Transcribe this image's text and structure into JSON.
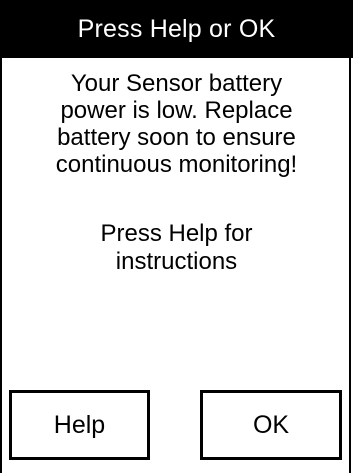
{
  "dialog": {
    "title": "Press Help or OK",
    "message_lines": [
      "Your Sensor battery",
      "power is low. Replace",
      "battery soon to ensure",
      "continuous monitoring!"
    ],
    "instruction_lines": [
      "Press Help for",
      "instructions"
    ],
    "help_label": "Help",
    "ok_label": "OK"
  },
  "colors": {
    "title_background": "#000000",
    "title_text": "#ffffff",
    "background": "#ffffff",
    "text": "#000000"
  }
}
